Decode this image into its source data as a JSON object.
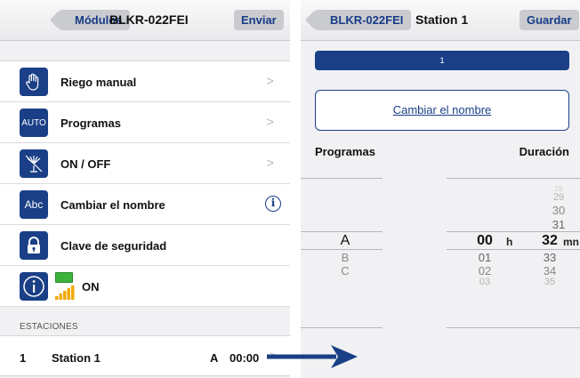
{
  "left": {
    "navbar": {
      "back_label": "Módulos",
      "title": "BLKR-022FEI",
      "action_label": "Enviar"
    },
    "menu": [
      {
        "icon": "hand-icon",
        "label": "Riego manual"
      },
      {
        "icon": "auto-icon",
        "icon_text": "AUTO",
        "label": "Programas"
      },
      {
        "icon": "sprinkler-off-icon",
        "label": "ON / OFF"
      },
      {
        "icon": "abc-icon",
        "icon_text": "Abc",
        "label": "Cambiar el nombre"
      },
      {
        "icon": "lock-icon",
        "label": "Clave de seguridad"
      },
      {
        "icon": "info-icon",
        "label": "ON"
      }
    ],
    "section_header": "ESTACIONES",
    "station": {
      "number": "1",
      "name": "Station 1",
      "program": "A",
      "time": "00:00"
    }
  },
  "right": {
    "navbar": {
      "back_label": "BLKR-022FEI",
      "title": "Station 1",
      "action_label": "Guardar"
    },
    "progress_label": "1",
    "rename_label": "Cambiar el nombre",
    "programs_header": "Programas",
    "duration_header": "Duración",
    "programs": {
      "selected": "A",
      "below": [
        "B",
        "C"
      ]
    },
    "hours": {
      "selected": "00",
      "below": [
        "01",
        "02",
        "03"
      ],
      "unit": "h"
    },
    "minutes": {
      "above": [
        "29",
        "30",
        "31"
      ],
      "selected": "32",
      "below": [
        "33",
        "34",
        "35"
      ],
      "unit": "mn"
    }
  },
  "colors": {
    "accent": "#1a3f86",
    "background": "#f1f1f4",
    "battery": "#3bb33b",
    "signal": "#f2a900"
  }
}
